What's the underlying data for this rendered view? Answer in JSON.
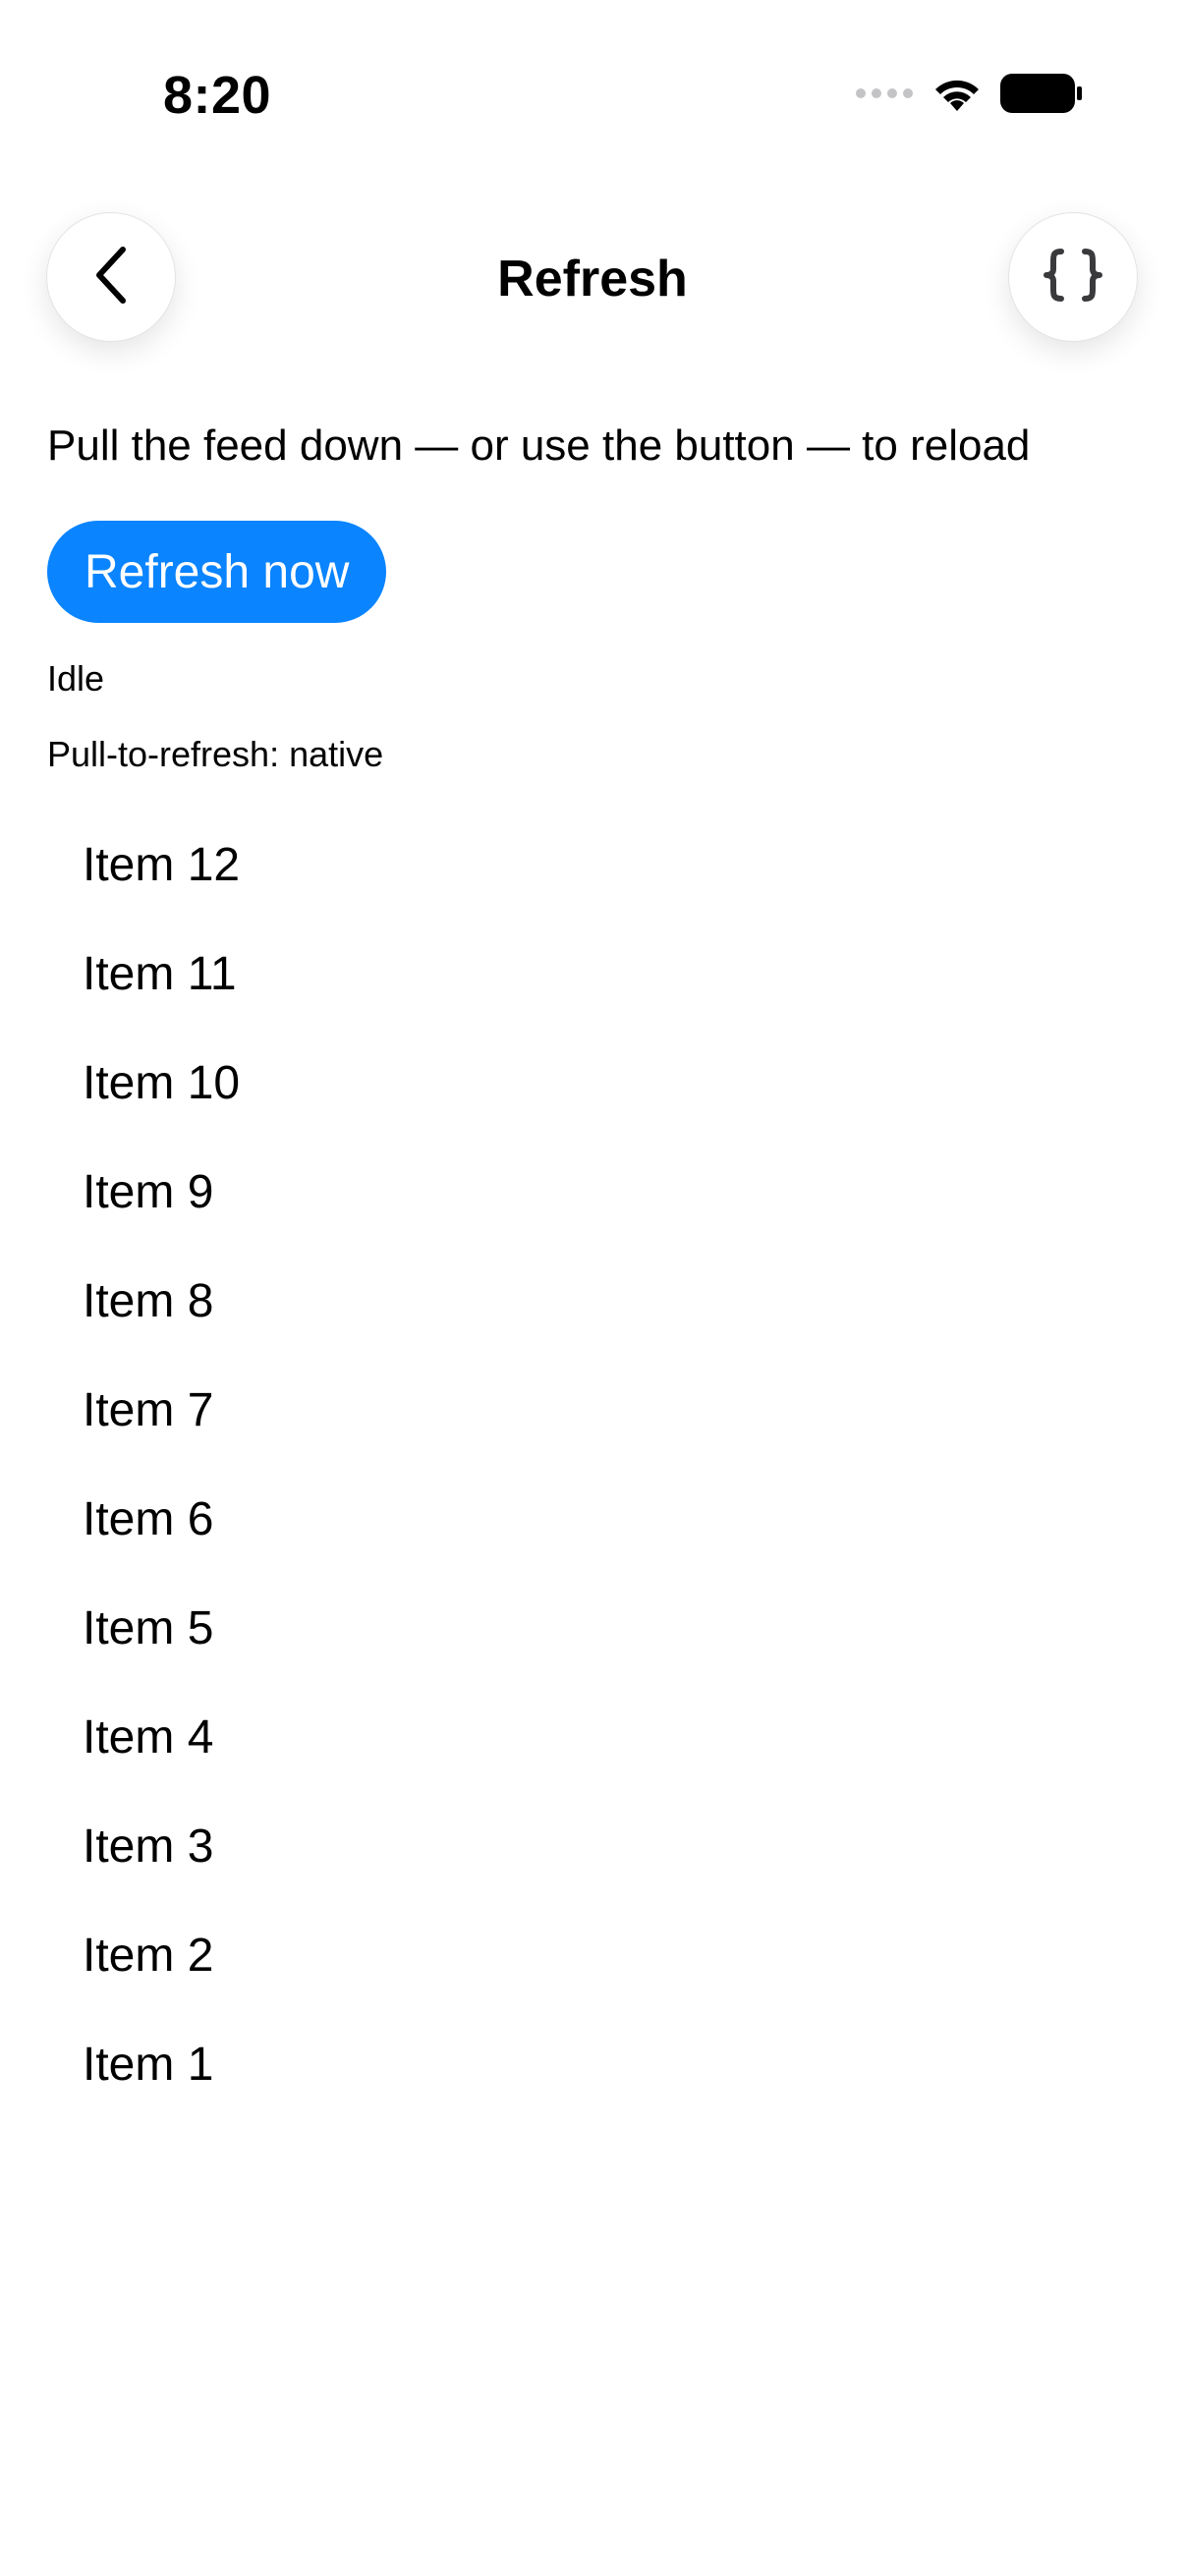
{
  "status_bar": {
    "time": "8:20",
    "icons": [
      "signal-dots-icon",
      "wifi-icon",
      "battery-icon"
    ]
  },
  "nav": {
    "title": "Refresh",
    "back_icon": "chevron-left-icon",
    "right_icon": "curly-braces-icon"
  },
  "main": {
    "hint": "Pull the feed down — or use the button — to reload",
    "refresh_button_label": "Refresh now",
    "status": "Idle",
    "mode": "Pull-to-refresh: native",
    "items": [
      "Item 12",
      "Item 11",
      "Item 10",
      "Item 9",
      "Item 8",
      "Item 7",
      "Item 6",
      "Item 5",
      "Item 4",
      "Item 3",
      "Item 2",
      "Item 1"
    ]
  },
  "colors": {
    "accent": "#0a84ff",
    "background": "#ffffff",
    "text": "#000000"
  }
}
